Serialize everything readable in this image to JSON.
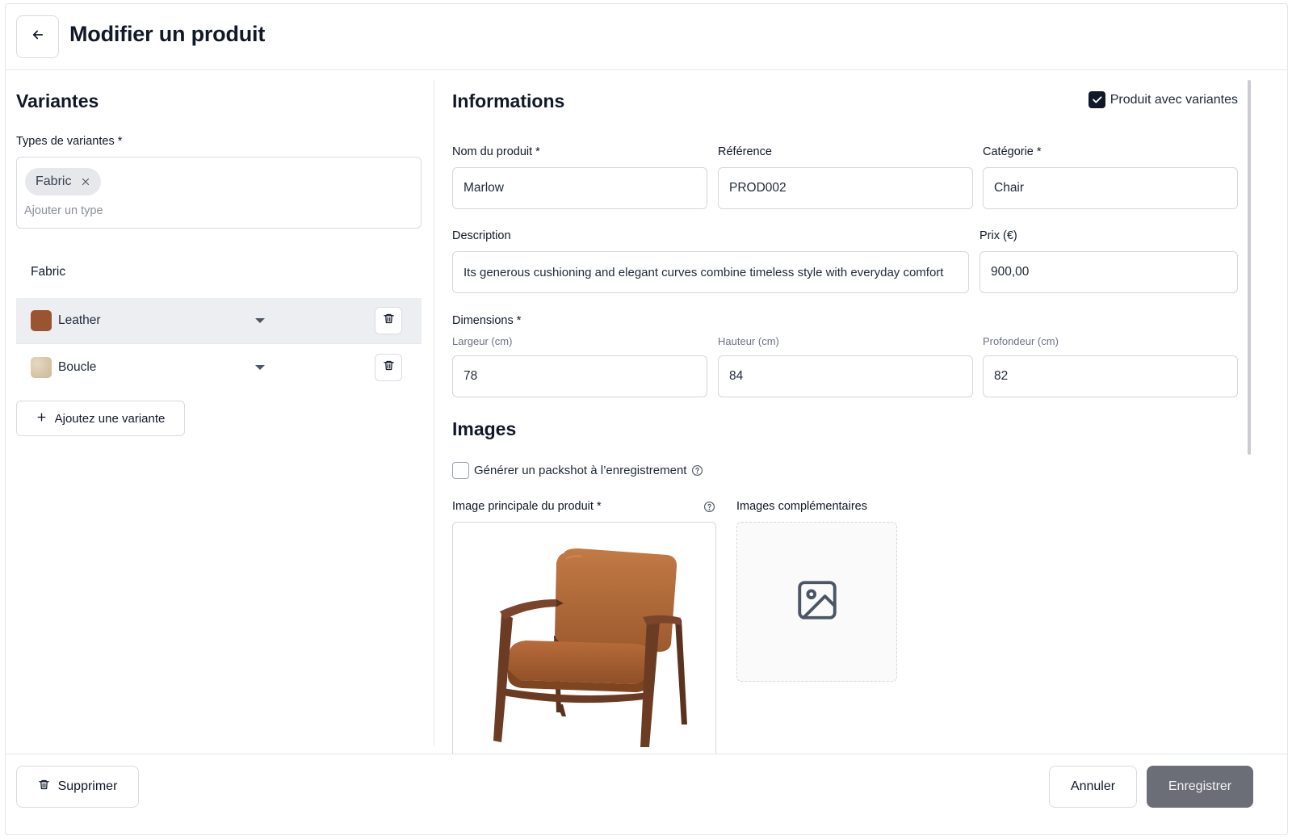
{
  "header": {
    "title": "Modifier un produit"
  },
  "variants_panel": {
    "title": "Variantes",
    "types_label": "Types de variantes *",
    "type_chips": [
      {
        "label": "Fabric"
      }
    ],
    "types_placeholder": "Ajouter un type",
    "group_title": "Fabric",
    "options": [
      {
        "label": "Leather",
        "swatch_color": "#9a5530"
      },
      {
        "label": "Boucle",
        "swatch_color": "#d9c9b0"
      }
    ],
    "add_button": "Ajoutez une variante"
  },
  "info": {
    "title": "Informations",
    "with_variants_label": "Produit avec variantes",
    "with_variants_checked": true,
    "name_label": "Nom du produit *",
    "name_value": "Marlow",
    "ref_label": "Référence",
    "ref_value": "PROD002",
    "category_label": "Catégorie *",
    "category_value": "Chair",
    "description_label": "Description",
    "description_value": "Its generous cushioning and elegant curves combine timeless style with everyday comfort",
    "price_label": "Prix (€)",
    "price_value": "900,00",
    "dimensions_label": "Dimensions *",
    "width_label": "Largeur (cm)",
    "width_value": "78",
    "height_label": "Hauteur (cm)",
    "height_value": "84",
    "depth_label": "Profondeur (cm)",
    "depth_value": "82"
  },
  "images": {
    "title": "Images",
    "packshot_label": "Générer un packshot à l’enregistrement",
    "packshot_checked": false,
    "main_label": "Image principale du produit *",
    "extra_label": "Images complémentaires"
  },
  "footer": {
    "delete": "Supprimer",
    "cancel": "Annuler",
    "save": "Enregistrer"
  },
  "colors": {
    "primary_button": "#6b6e76",
    "checkbox": "#111827"
  }
}
